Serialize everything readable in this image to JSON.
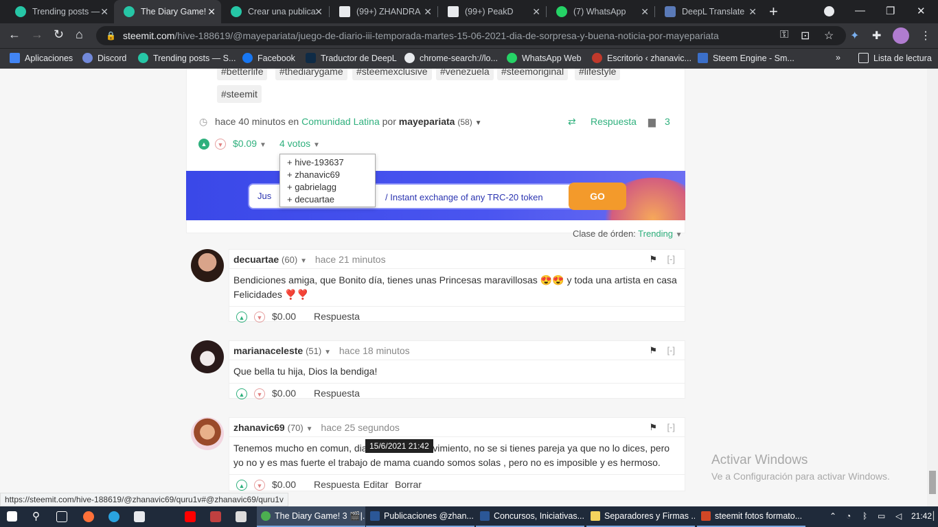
{
  "browser": {
    "tabs": [
      {
        "title": "Trending posts —",
        "active": false
      },
      {
        "title": "The Diary Game!",
        "active": true
      },
      {
        "title": "Crear una publica",
        "active": false
      },
      {
        "title": "(99+) ZHANDRA",
        "active": false
      },
      {
        "title": "(99+) PeakD",
        "active": false
      },
      {
        "title": "(7) WhatsApp",
        "active": false
      },
      {
        "title": "DeepL Translate",
        "active": false
      }
    ],
    "url_domain": "steemit.com",
    "url_path": "/hive-188619/@mayepariata/juego-de-diario-iii-temporada-martes-15-06-2021-dia-de-sorpresa-y-buena-noticia-por-mayepariata",
    "bookmarks": [
      "Aplicaciones",
      "Discord",
      "Trending posts — S...",
      "Facebook",
      "Traductor de DeepL",
      "chrome-search://lo...",
      "WhatsApp Web",
      "Escritorio ‹ zhanavic...",
      "Steem Engine - Sm..."
    ],
    "reading_list": "Lista de lectura",
    "more_bookmarks": "»"
  },
  "post": {
    "tags_row1": [
      "#betterlife",
      "#thediarygame",
      "#steemexclusive",
      "#venezuela",
      "#steemoriginal",
      "#lifestyle"
    ],
    "tags_row2": [
      "#steemit"
    ],
    "time": "hace 40 minutos en",
    "community": "Comunidad Latina",
    "by": "por",
    "author": "mayepariata",
    "author_rep": "(58)",
    "reply_label": "Respuesta",
    "comment_count": "3",
    "payout": "$0.09",
    "votes_label": "4 votos",
    "voters": [
      "+ hive-193637",
      "+ zhanavic69",
      "+ gabrielagg",
      "+ decuartae"
    ]
  },
  "banner": {
    "text": "/ Instant exchange of any TRC-20 token",
    "left_text": "Jus",
    "button": "GO"
  },
  "sort": {
    "label": "Clase de órden:",
    "value": "Trending"
  },
  "comments": [
    {
      "author": "decuartae",
      "rep": "(60)",
      "time": "hace 21 minutos",
      "body": "Bendiciones amiga, que Bonito día, tienes unas Princesas maravillosas 😍😍 y toda una artista en casa Felicidades ❣️❣️",
      "payout": "$0.00",
      "reply": "Respuesta"
    },
    {
      "author": "marianaceleste",
      "rep": "(51)",
      "time": "hace 18 minutos",
      "body": "Que bella tu hija, Dios la bendiga!",
      "payout": "$0.00",
      "reply": "Respuesta"
    },
    {
      "author": "zhanavic69",
      "rep": "(70)",
      "time": "hace 25 segundos",
      "body": "Tenemos mucho en comun, dias de mucho movimiento, no se si tienes pareja ya que no lo dices, pero yo no y es mas fuerte el trabajo de mama cuando somos solas , pero no es imposible y es hermoso.",
      "payout": "$0.00",
      "reply": "Respuesta",
      "edit": "Editar",
      "delete": "Borrar"
    }
  ],
  "collapse_label": "[-]",
  "tooltip": "15/6/2021 21:42",
  "status_url": "https://steemit.com/hive-188619/@zhanavic69/quru1v#@zhanavic69/quru1v",
  "windows_activation": {
    "title": "Activar Windows",
    "subtitle": "Ve a Configuración para activar Windows."
  },
  "taskbar": {
    "apps": [
      "The Diary Game! 3 🎬|...",
      "Publicaciones @zhan...",
      "Concursos, Iniciativas...",
      "Separadores y Firmas ...",
      "steemit fotos formato..."
    ],
    "clock": "21:42"
  },
  "colors": {
    "accent": "#2fb07d",
    "tab_bg": "#202124",
    "toolbar_bg": "#35363a",
    "taskbar_bg": "#1f2a3a"
  }
}
